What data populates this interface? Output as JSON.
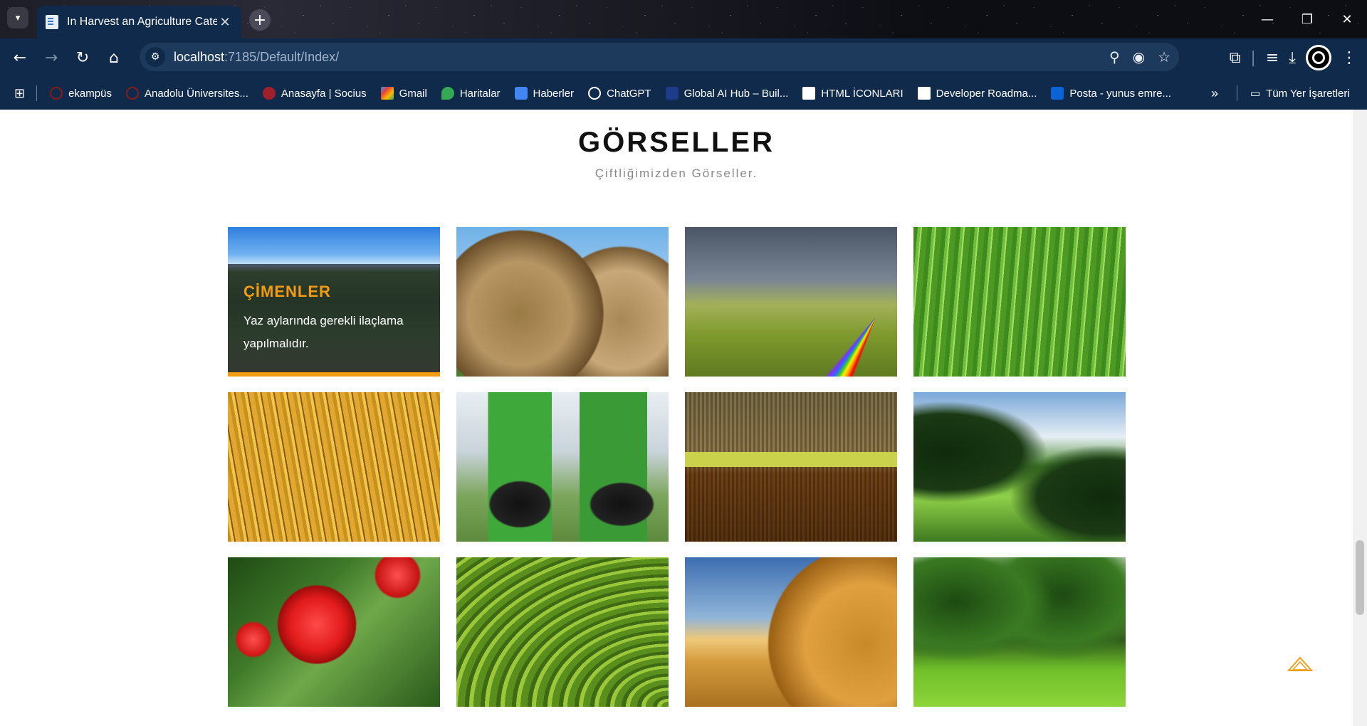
{
  "browser": {
    "tab_title": "In Harvest an Agriculture Categ",
    "tab_close": "✕",
    "new_tab": "+",
    "url_host": "localhost",
    "url_path": ":7185/Default/Index/",
    "bookmarks": [
      {
        "label": "ekampüs",
        "color": "#8b1a1a"
      },
      {
        "label": "Anadolu Üniversites...",
        "color": "#8b1a1a"
      },
      {
        "label": "Anasayfa | Socius",
        "color": "#a11f2a"
      },
      {
        "label": "Gmail",
        "color": "#d93025"
      },
      {
        "label": "Haritalar",
        "color": "#34a853"
      },
      {
        "label": "Haberler",
        "color": "#4285f4"
      },
      {
        "label": "ChatGPT",
        "color": "#ffffff"
      },
      {
        "label": "Global AI Hub – Buil...",
        "color": "#1e3a8a"
      },
      {
        "label": "HTML İCONLARI",
        "color": "#ffffff"
      },
      {
        "label": "Developer Roadma...",
        "color": "#ffffff"
      },
      {
        "label": "Posta - yunus emre...",
        "color": "#0a64d8"
      }
    ],
    "bookmarks_more": "»",
    "all_bookmarks": "Tüm Yer İşaretleri"
  },
  "section": {
    "title": "GÖRSELLER",
    "subtitle": "Çiftliğimizden Görseller."
  },
  "gallery": {
    "overlay_title": "ÇİMENLER",
    "overlay_text": "Yaz aylarında gerekli ilaçlama yapılmalıdır.",
    "accent_color": "#f39c12",
    "tiles": [
      "grass field",
      "hay bale",
      "rainbow hills",
      "green wheat",
      "golden wheat",
      "tractors",
      "combine harvester",
      "green meadow",
      "red apples",
      "rice terraces",
      "straw bale",
      "palm trees"
    ]
  }
}
